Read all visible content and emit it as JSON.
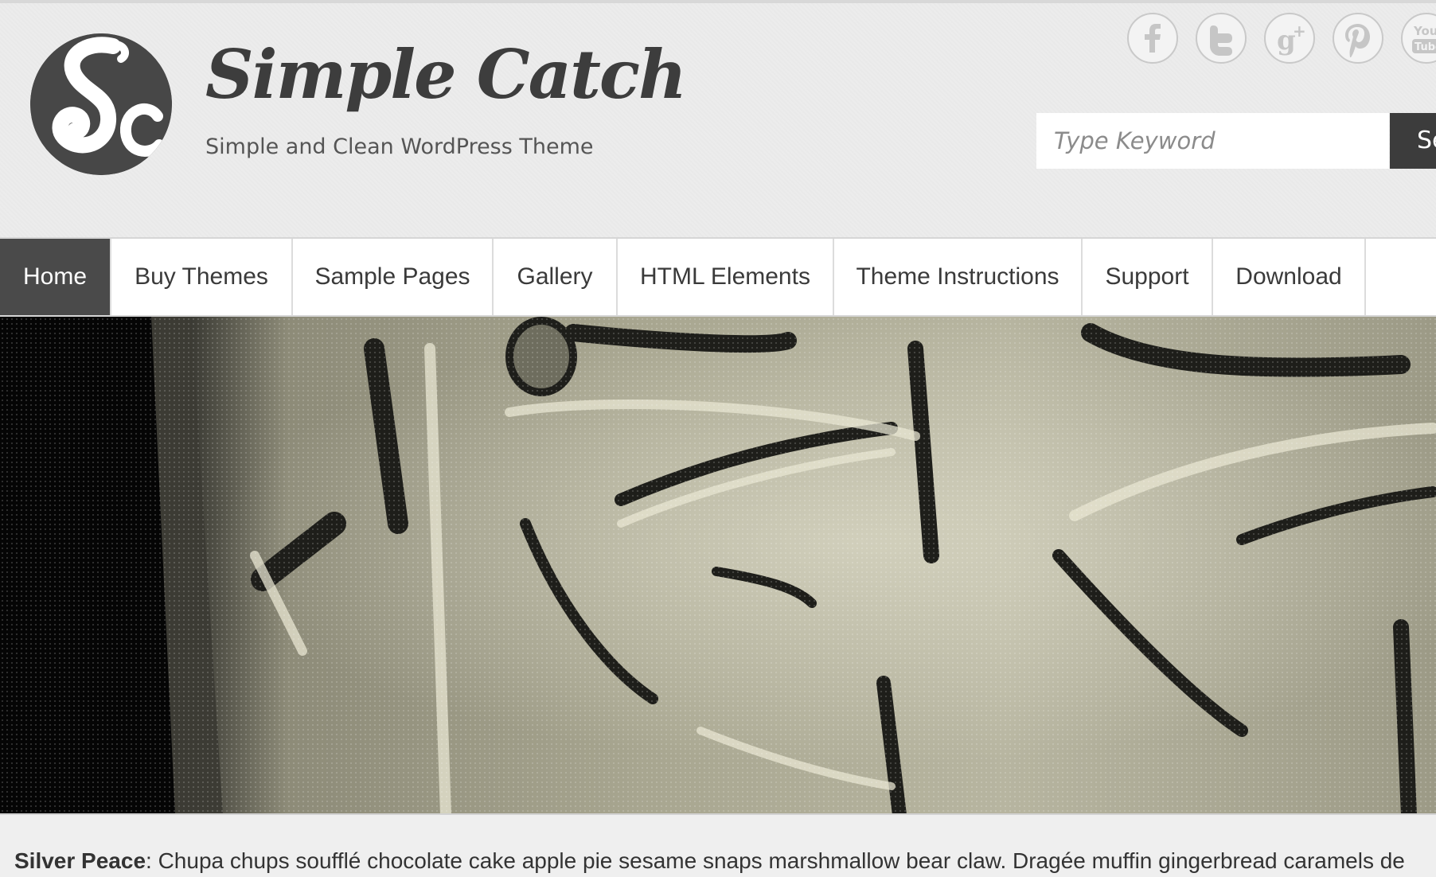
{
  "site": {
    "title": "Simple Catch",
    "tagline": "Simple and Clean WordPress Theme",
    "logo_letters": "Sc"
  },
  "social": [
    {
      "icon": "facebook-icon",
      "glyph": "f"
    },
    {
      "icon": "twitter-icon",
      "glyph": "t"
    },
    {
      "icon": "google-plus-icon",
      "glyph": "g+"
    },
    {
      "icon": "pinterest-icon",
      "glyph": "P"
    },
    {
      "icon": "youtube-icon",
      "glyph": "You Tube"
    }
  ],
  "search": {
    "placeholder": "Type Keyword",
    "button_label": "Search"
  },
  "nav": {
    "items": [
      {
        "label": "Home",
        "active": true
      },
      {
        "label": "Buy Themes",
        "active": false
      },
      {
        "label": "Sample Pages",
        "active": false
      },
      {
        "label": "Gallery",
        "active": false
      },
      {
        "label": "HTML Elements",
        "active": false
      },
      {
        "label": "Theme Instructions",
        "active": false
      },
      {
        "label": "Support",
        "active": false
      },
      {
        "label": "Download",
        "active": false
      }
    ]
  },
  "featured": {
    "title": "Silver Peace",
    "excerpt": ": Chupa chups soufflé chocolate cake apple pie sesame snaps marshmallow bear claw. Dragée muffin gingerbread caramels de"
  },
  "colors": {
    "nav_active_bg": "#4a4a4a",
    "header_bg": "#ececec",
    "search_button_bg": "#3c3c3c",
    "title_color": "#3d3d3d"
  }
}
